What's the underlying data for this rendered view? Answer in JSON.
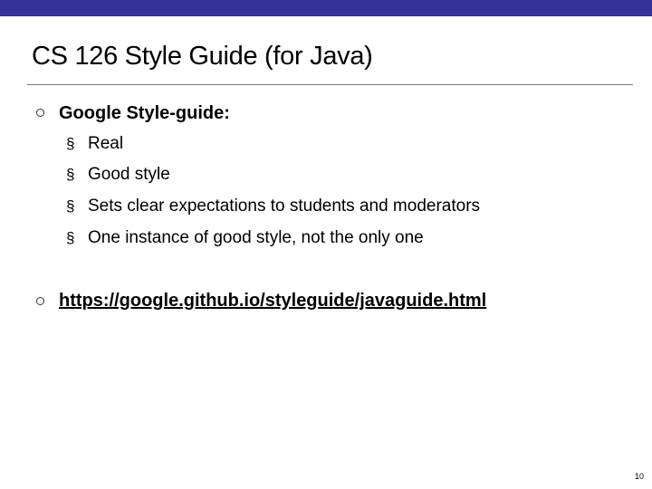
{
  "slide": {
    "title": "CS 126 Style Guide (for Java)",
    "bullets": [
      {
        "text": "Google Style-guide:",
        "sub": [
          "Real",
          "Good style",
          "Sets clear expectations to students and moderators",
          "One instance of good style, not the only one"
        ]
      },
      {
        "text": "https://google.github.io/styleguide/javaguide.html"
      }
    ],
    "page_number": "10",
    "sub_bullet_glyph": "§"
  },
  "colors": {
    "top_bar": "#333399",
    "rule": "#7a7a7a"
  }
}
